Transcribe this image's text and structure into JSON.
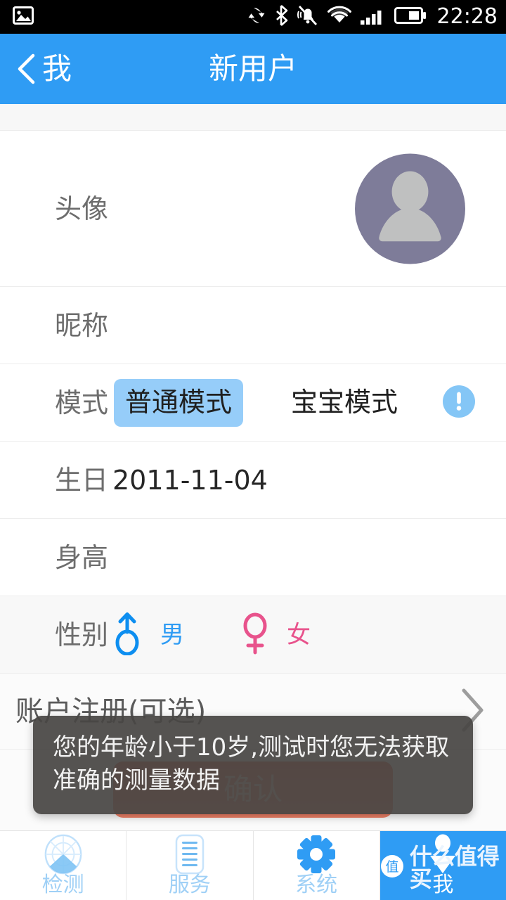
{
  "statusbar": {
    "time": "22:28",
    "icons": [
      "photo-icon",
      "sync-icon",
      "bluetooth-icon",
      "silent-vibrate-icon",
      "wifi-icon",
      "signal-icon",
      "battery-icon"
    ]
  },
  "appbar": {
    "back_label": "我",
    "title": "新用户",
    "back_icon": "chevron-left-icon",
    "bg_color": "#2f9cf4"
  },
  "form": {
    "avatar": {
      "label": "头像",
      "icon": "person-avatar-icon",
      "bg_color": "#7e7c99",
      "fg_color": "#bfc0c0"
    },
    "nickname": {
      "label": "昵称",
      "value": "",
      "placeholder": ""
    },
    "mode": {
      "label": "模式",
      "options": [
        {
          "label": "普通模式",
          "selected": true
        },
        {
          "label": "宝宝模式",
          "selected": false
        }
      ],
      "selected_bg": "#96cdf9",
      "info_icon": "info-exclamation-icon"
    },
    "birthday": {
      "label": "生日",
      "value": "2011-11-04"
    },
    "height": {
      "label": "身高",
      "value": ""
    },
    "gender": {
      "label": "性别",
      "male": {
        "label": "男",
        "icon": "male-symbol-icon",
        "color": "#2f9cf4"
      },
      "female": {
        "label": "女",
        "icon": "female-symbol-icon",
        "color": "#e8538c"
      }
    },
    "account": {
      "label": "账户注册(可选)",
      "chevron": "chevron-right-icon"
    }
  },
  "confirm_button": {
    "label": "确认",
    "color": "#ef6b52"
  },
  "toast": {
    "message": "您的年龄小于10岁,测试时您无法获取准确的测量数据"
  },
  "tabbar": {
    "items": [
      {
        "label": "检测",
        "icon": "radar-icon",
        "active": false
      },
      {
        "label": "服务",
        "icon": "document-list-icon",
        "active": false
      },
      {
        "label": "系统",
        "icon": "gear-icon",
        "active": false
      },
      {
        "label": "我",
        "icon": "person-icon",
        "active": true
      }
    ]
  },
  "watermark": {
    "text": "什么值得买",
    "badge": "值"
  }
}
